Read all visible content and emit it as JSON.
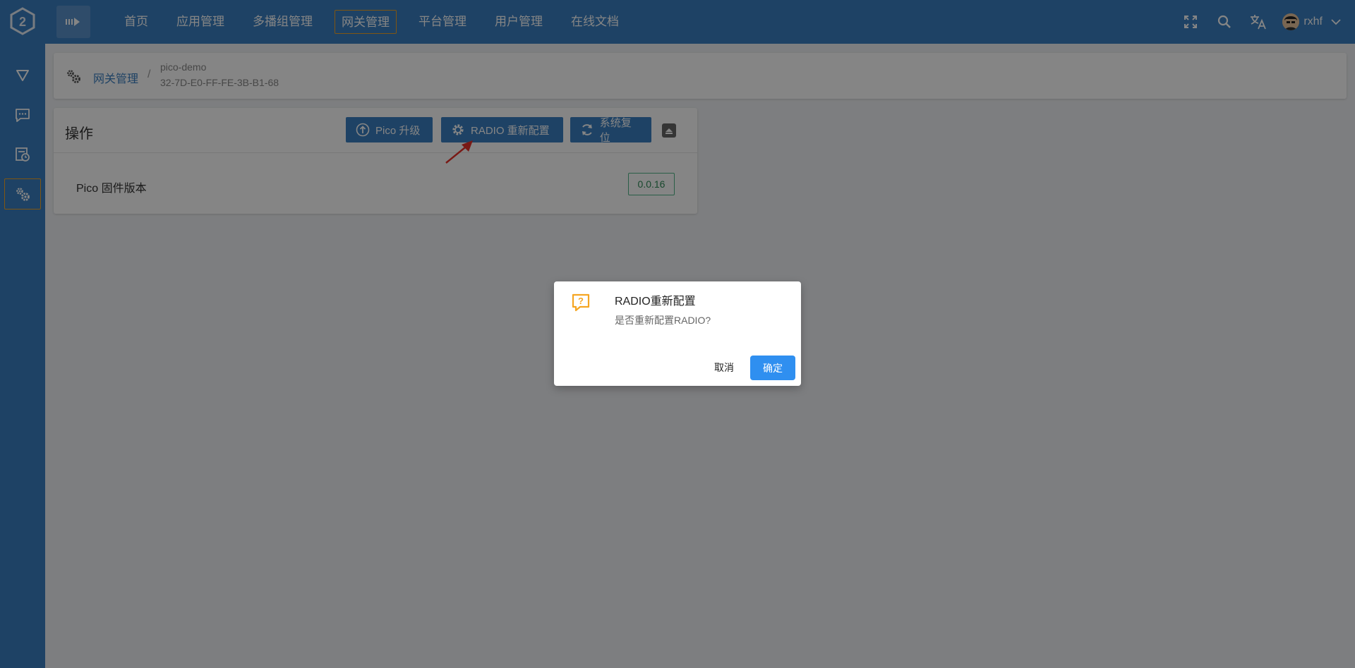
{
  "nav": {
    "items": [
      "首页",
      "应用管理",
      "多播组管理",
      "网关管理",
      "平台管理",
      "用户管理",
      "在线文档"
    ],
    "active_index": 3
  },
  "user": {
    "name": "rxhf"
  },
  "breadcrumb": {
    "section": "网关管理",
    "separator": "/",
    "gateway_name": "pico-demo",
    "gateway_id": "32-7D-E0-FF-FE-3B-B1-68"
  },
  "operations": {
    "title": "操作",
    "pico_upgrade_label": "Pico 升级",
    "radio_reconfig_label": "RADIO 重新配置",
    "system_reset_label": "系统复位",
    "firmware_label": "Pico 固件版本",
    "firmware_version": "0.0.16"
  },
  "dialog": {
    "title": "RADIO重新配置",
    "message": "是否重新配置RADIO?",
    "cancel_label": "取消",
    "ok_label": "确定"
  },
  "colors": {
    "primary": "#3a7fc1",
    "accent": "#f5a623",
    "ok_button": "#2f8ff0",
    "version_green": "#52b788"
  }
}
